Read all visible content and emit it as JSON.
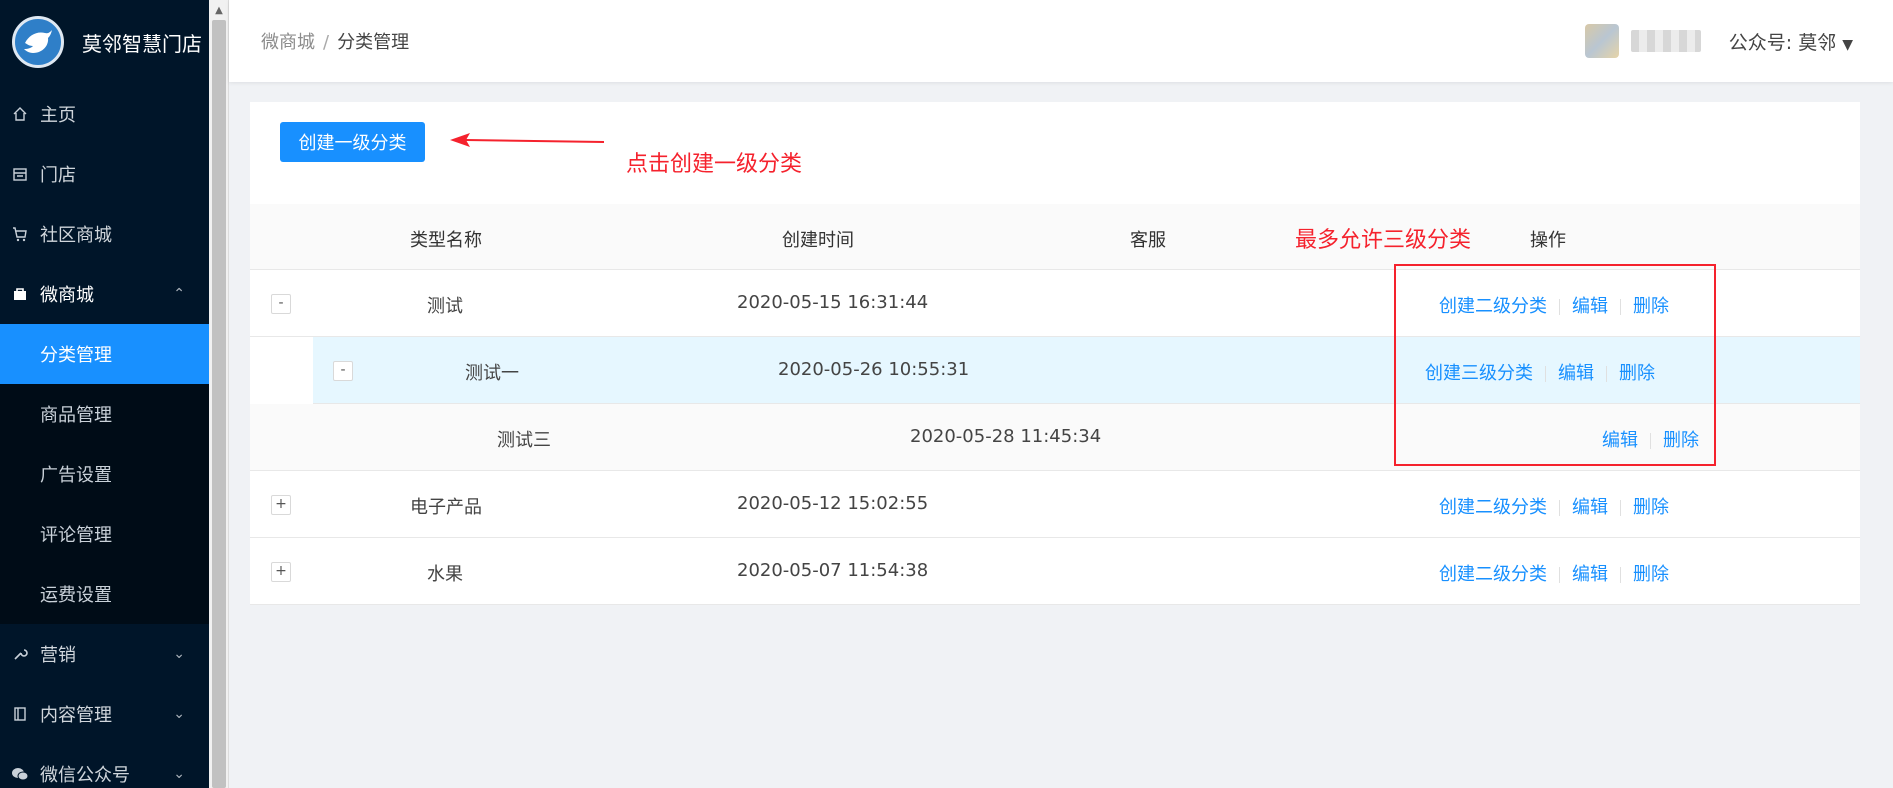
{
  "app": {
    "title": "莫邻智慧门店"
  },
  "sidebar": {
    "items": [
      {
        "label": "主页",
        "icon": "home-icon"
      },
      {
        "label": "门店",
        "icon": "store-icon"
      },
      {
        "label": "社区商城",
        "icon": "cart-icon"
      },
      {
        "label": "微商城",
        "icon": "bag-icon",
        "open": true,
        "children": [
          {
            "label": "分类管理",
            "active": true
          },
          {
            "label": "商品管理"
          },
          {
            "label": "广告设置"
          },
          {
            "label": "评论管理"
          },
          {
            "label": "运费设置"
          }
        ]
      },
      {
        "label": "营销",
        "icon": "wrench-icon"
      },
      {
        "label": "内容管理",
        "icon": "document-icon"
      },
      {
        "label": "微信公众号",
        "icon": "wechat-icon"
      }
    ]
  },
  "header": {
    "breadcrumb": [
      "微商城",
      "分类管理"
    ],
    "breadcrumb_sep": "/",
    "account": "公众号: 莫邻"
  },
  "toolbar": {
    "create_label": "创建一级分类"
  },
  "annotations": {
    "arrow_note": "点击创建一级分类",
    "levels_note": "最多允许三级分类"
  },
  "table": {
    "columns": [
      "类型名称",
      "创建时间",
      "客服",
      "操作"
    ],
    "rows": [
      {
        "level": 1,
        "expander": "-",
        "name": "测试",
        "created": "2020-05-15 16:31:44",
        "actions": [
          "创建二级分类",
          "编辑",
          "删除"
        ]
      },
      {
        "level": 2,
        "expander": "-",
        "name": "测试一",
        "created": "2020-05-26 10:55:31",
        "actions": [
          "创建三级分类",
          "编辑",
          "删除"
        ]
      },
      {
        "level": 3,
        "name": "测试三",
        "created": "2020-05-28 11:45:34",
        "actions": [
          "编辑",
          "删除"
        ]
      },
      {
        "level": 1,
        "expander": "+",
        "name": "电子产品",
        "created": "2020-05-12 15:02:55",
        "actions": [
          "创建二级分类",
          "编辑",
          "删除"
        ]
      },
      {
        "level": 1,
        "expander": "+",
        "name": "水果",
        "created": "2020-05-07 11:54:38",
        "actions": [
          "创建二级分类",
          "编辑",
          "删除"
        ]
      }
    ]
  },
  "colors": {
    "primary": "#1890ff",
    "sidebar_bg": "#001529",
    "annotation": "#f5222d"
  }
}
